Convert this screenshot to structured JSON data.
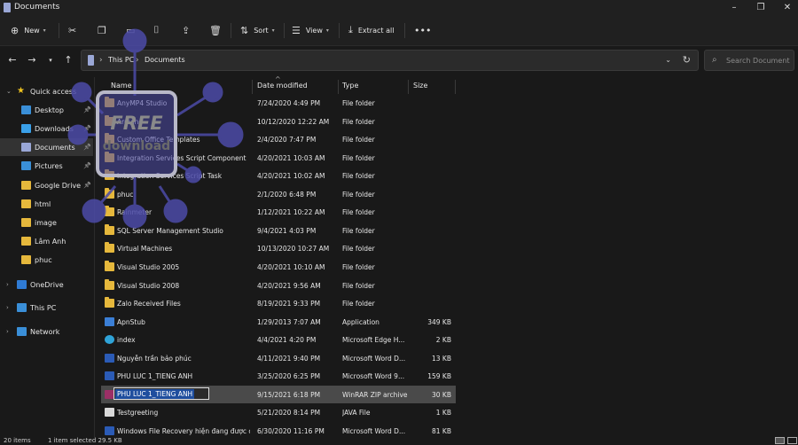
{
  "window": {
    "title": "Documents"
  },
  "toolbar": {
    "new_label": "New",
    "sort_label": "Sort",
    "view_label": "View",
    "extract_label": "Extract all"
  },
  "address": {
    "crumbs": [
      "This PC",
      "Documents"
    ]
  },
  "search": {
    "placeholder": "Search Documents"
  },
  "sidebar": {
    "items": [
      {
        "label": "Quick access",
        "icon": "star-icon"
      },
      {
        "label": "Desktop",
        "icon": "desktop-icon"
      },
      {
        "label": "Downloads",
        "icon": "downloads-icon"
      },
      {
        "label": "Documents",
        "icon": "documents-icon"
      },
      {
        "label": "Pictures",
        "icon": "pictures-icon"
      },
      {
        "label": "Google Drive",
        "icon": "folder-icon"
      },
      {
        "label": "html",
        "icon": "folder-icon"
      },
      {
        "label": "image",
        "icon": "folder-icon"
      },
      {
        "label": "Lâm Anh",
        "icon": "folder-icon"
      },
      {
        "label": "phuc",
        "icon": "folder-icon"
      },
      {
        "label": "OneDrive",
        "icon": "cloud-icon"
      },
      {
        "label": "This PC",
        "icon": "pc-icon"
      },
      {
        "label": "Network",
        "icon": "network-icon"
      }
    ]
  },
  "columns": {
    "name": "Name",
    "date": "Date modified",
    "type": "Type",
    "size": "Size"
  },
  "files": [
    {
      "name": "AnyMP4 Studio",
      "date": "7/24/2020 4:49 PM",
      "type": "File folder",
      "size": "",
      "icon": "folder-icon"
    },
    {
      "name": "Arduino",
      "date": "10/12/2020 12:22 AM",
      "type": "File folder",
      "size": "",
      "icon": "folder-icon"
    },
    {
      "name": "Custom Office Templates",
      "date": "2/4/2020 7:47 PM",
      "type": "File folder",
      "size": "",
      "icon": "folder-icon"
    },
    {
      "name": "Integration Services Script Component",
      "date": "4/20/2021 10:03 AM",
      "type": "File folder",
      "size": "",
      "icon": "folder-icon"
    },
    {
      "name": "Integration Services Script Task",
      "date": "4/20/2021 10:02 AM",
      "type": "File folder",
      "size": "",
      "icon": "folder-icon"
    },
    {
      "name": "phuc",
      "date": "2/1/2020 6:48 PM",
      "type": "File folder",
      "size": "",
      "icon": "folder-icon"
    },
    {
      "name": "Rainmeter",
      "date": "1/12/2021 10:22 AM",
      "type": "File folder",
      "size": "",
      "icon": "folder-icon"
    },
    {
      "name": "SQL Server Management Studio",
      "date": "9/4/2021 4:03 PM",
      "type": "File folder",
      "size": "",
      "icon": "folder-icon"
    },
    {
      "name": "Virtual Machines",
      "date": "10/13/2020 10:27 AM",
      "type": "File folder",
      "size": "",
      "icon": "folder-icon"
    },
    {
      "name": "Visual Studio 2005",
      "date": "4/20/2021 10:10 AM",
      "type": "File folder",
      "size": "",
      "icon": "folder-icon"
    },
    {
      "name": "Visual Studio 2008",
      "date": "4/20/2021 9:56 AM",
      "type": "File folder",
      "size": "",
      "icon": "folder-icon"
    },
    {
      "name": "Zalo Received Files",
      "date": "8/19/2021 9:33 PM",
      "type": "File folder",
      "size": "",
      "icon": "folder-icon"
    },
    {
      "name": "ApnStub",
      "date": "1/29/2013 7:07 AM",
      "type": "Application",
      "size": "349 KB",
      "icon": "app-icon"
    },
    {
      "name": "index",
      "date": "4/4/2021 4:20 PM",
      "type": "Microsoft Edge H...",
      "size": "2 KB",
      "icon": "edge-icon"
    },
    {
      "name": "Nguyễn trần bảo phúc",
      "date": "4/11/2021 9:40 PM",
      "type": "Microsoft Word D...",
      "size": "13 KB",
      "icon": "word-icon"
    },
    {
      "name": "PHU LUC 1_TIENG ANH",
      "date": "3/25/2020 6:25 PM",
      "type": "Microsoft Word 9...",
      "size": "159 KB",
      "icon": "word-icon"
    },
    {
      "name": "PHU LUC 1_TIENG ANH",
      "date": "9/15/2021 6:18 PM",
      "type": "WinRAR ZIP archive",
      "size": "30 KB",
      "icon": "zip-icon",
      "selected": true
    },
    {
      "name": "Testgreeting",
      "date": "5/21/2020 8:14 PM",
      "type": "JAVA File",
      "size": "1 KB",
      "icon": "file-icon"
    },
    {
      "name": "Windows File Recovery hiện đang được c...",
      "date": "6/30/2020 11:16 PM",
      "type": "Microsoft Word D...",
      "size": "81 KB",
      "icon": "word-icon"
    }
  ],
  "status": {
    "count": "20 items",
    "selection": "1 item selected  29.5 KB"
  },
  "watermark": {
    "line1": "FREE",
    "line2": "download"
  },
  "colors": {
    "folder": "#e6b83c",
    "selection": "#4a4a4a",
    "rename_highlight": "#1f4e9e",
    "watermark": "#4c4ba8"
  }
}
